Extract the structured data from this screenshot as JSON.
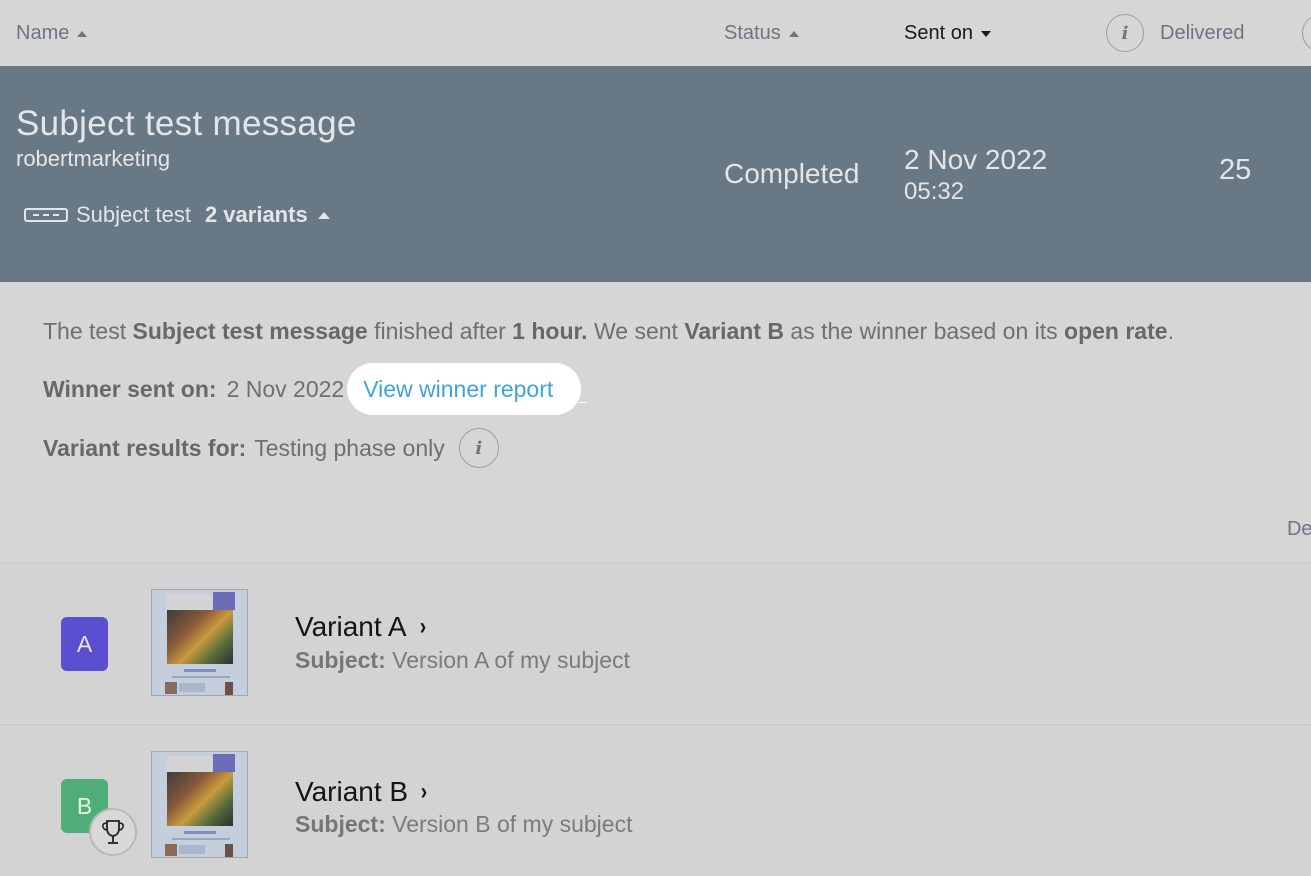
{
  "table_header": {
    "name": "Name",
    "status": "Status",
    "sent_on": "Sent on",
    "info_icon": "i",
    "delivered": "Delivered"
  },
  "campaign": {
    "title": "Subject test message",
    "account": "robertmarketing",
    "type_icon": "keyboard-icon",
    "type_label": "Subject test",
    "variants_label": "2 variants",
    "status": "Completed",
    "sent_date": "2 Nov 2022",
    "sent_time": "05:32",
    "delivered": "25",
    "row_color": "#697885"
  },
  "detail": {
    "summary": {
      "p1": "The test ",
      "b1": "Subject test message",
      "p2": " finished after ",
      "b2": "1 hour.",
      "p3": " We sent ",
      "b3": "Variant B",
      "p4": " as the winner based on its ",
      "b4": "open rate",
      "p5": "."
    },
    "winner_label": "Winner sent on:",
    "winner_date": "2 Nov 2022",
    "view_report_link": "View winner report",
    "results_label": "Variant results for:",
    "results_value": "Testing phase only",
    "info_icon": "i",
    "column_clipped": "Del",
    "link_color": "#3fa3de"
  },
  "variants": [
    {
      "badge": "A",
      "badge_color": "#5b4fcf",
      "name": "Variant A",
      "chevron": "›",
      "subject_label": "Subject:",
      "subject": "Version A of my subject",
      "winner": false
    },
    {
      "badge": "B",
      "badge_color": "#4fae78",
      "name": "Variant B",
      "chevron": "›",
      "subject_label": "Subject:",
      "subject": "Version B of my subject",
      "winner": true
    }
  ]
}
